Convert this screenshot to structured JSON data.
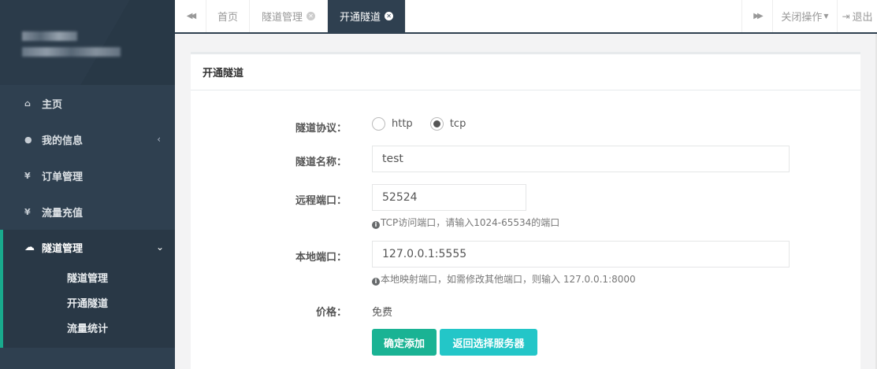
{
  "sidebar": {
    "items": [
      {
        "icon": "home-icon",
        "glyph": "⌂",
        "label": "主页"
      },
      {
        "icon": "user-icon",
        "glyph": "●",
        "label": "我的信息",
        "arrow": "‹"
      },
      {
        "icon": "yen-icon",
        "glyph": "¥",
        "label": "订单管理"
      },
      {
        "icon": "yen-icon",
        "glyph": "¥",
        "label": "流量充值"
      }
    ],
    "active": {
      "icon": "cloud-icon",
      "glyph": "☁",
      "label": "隧道管理",
      "arrow": "⌄",
      "sub": [
        "隧道管理",
        "开通隧道",
        "流量统计"
      ]
    }
  },
  "topbar": {
    "back_glyph": "◀◀",
    "forward_glyph": "▶▶",
    "tabs": [
      {
        "label": "首页",
        "closable": false
      },
      {
        "label": "隧道管理",
        "closable": true
      },
      {
        "label": "开通隧道",
        "closable": true,
        "active": true
      }
    ],
    "close_ops_label": "关闭操作",
    "logout_label": "退出"
  },
  "panel": {
    "title": "开通隧道",
    "protocol": {
      "label": "隧道协议：",
      "options": [
        "http",
        "tcp"
      ],
      "selected": "tcp"
    },
    "name": {
      "label": "隧道名称：",
      "value": "test"
    },
    "remote_port": {
      "label": "远程端口：",
      "value": "52524",
      "hint": "TCP访问端口，请输入1024-65534的端口"
    },
    "local_port": {
      "label": "本地端口：",
      "value": "127.0.0.1:5555",
      "hint": "本地映射端口，如需修改其他端口，则输入 127.0.0.1:8000"
    },
    "price": {
      "label": "价格：",
      "value": "免费"
    },
    "buttons": {
      "confirm": "确定添加",
      "back": "返回选择服务器"
    }
  },
  "colors": {
    "sidebar": "#2f4050",
    "accent": "#1ab394",
    "info": "#23c6c8"
  }
}
